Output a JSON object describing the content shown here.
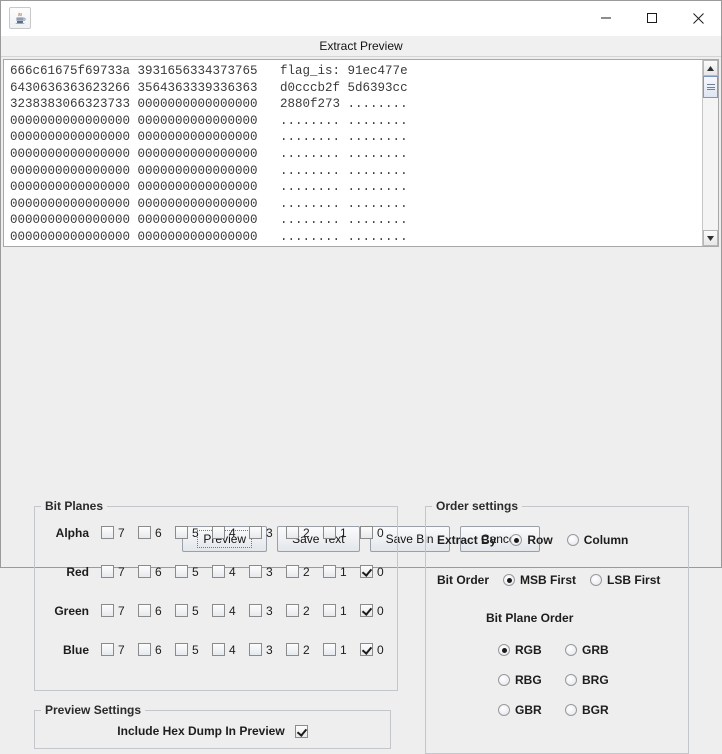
{
  "window": {
    "app_icon": "java-coffee-cup-icon",
    "title": "Extract Preview",
    "controls": {
      "minimize": "minimize-icon",
      "maximize": "maximize-icon",
      "close": "close-icon"
    }
  },
  "preview": {
    "scrollbar": {
      "up": "scroll-up-arrow-icon",
      "down": "scroll-down-arrow-icon"
    },
    "hex_lines": [
      "666c61675f69733a 3931656334373765   flag_is: 91ec477e",
      "6430636363623266 3564363339336363   d0cccb2f 5d6393cc",
      "3238383066323733 0000000000000000   2880f273 ........",
      "0000000000000000 0000000000000000   ........ ........",
      "0000000000000000 0000000000000000   ........ ........",
      "0000000000000000 0000000000000000   ........ ........",
      "0000000000000000 0000000000000000   ........ ........",
      "0000000000000000 0000000000000000   ........ ........",
      "0000000000000000 0000000000000000   ........ ........",
      "0000000000000000 0000000000000000   ........ ........",
      "0000000000000000 0000000000000000   ........ ........"
    ]
  },
  "bit_planes": {
    "legend": "Bit Planes",
    "bit_labels": [
      "7",
      "6",
      "5",
      "4",
      "3",
      "2",
      "1",
      "0"
    ],
    "rows": [
      {
        "channel": "Alpha",
        "checked": [
          false,
          false,
          false,
          false,
          false,
          false,
          false,
          false
        ]
      },
      {
        "channel": "Red",
        "checked": [
          false,
          false,
          false,
          false,
          false,
          false,
          false,
          true
        ]
      },
      {
        "channel": "Green",
        "checked": [
          false,
          false,
          false,
          false,
          false,
          false,
          false,
          true
        ]
      },
      {
        "channel": "Blue",
        "checked": [
          false,
          false,
          false,
          false,
          false,
          false,
          false,
          true
        ]
      }
    ]
  },
  "preview_settings": {
    "legend": "Preview Settings",
    "include_hex_dump_label": "Include Hex Dump In Preview",
    "include_hex_dump_checked": true
  },
  "order_settings": {
    "legend": "Order settings",
    "extract_by": {
      "label": "Extract By",
      "options": [
        "Row",
        "Column"
      ],
      "selected": "Row"
    },
    "bit_order": {
      "label": "Bit Order",
      "options": [
        "MSB First",
        "LSB First"
      ],
      "selected": "MSB First"
    },
    "bit_plane_order": {
      "label": "Bit Plane Order",
      "options": [
        "RGB",
        "GRB",
        "RBG",
        "BRG",
        "GBR",
        "BGR"
      ],
      "selected": "RGB"
    }
  },
  "buttons": [
    {
      "label": "Preview",
      "focused": true
    },
    {
      "label": "Save Text",
      "focused": false
    },
    {
      "label": "Save Bin",
      "focused": false
    },
    {
      "label": "Cancel",
      "focused": false
    }
  ],
  "colors": {
    "window_bg": "#eeeeee",
    "panel_border": "#c3c7cc",
    "text": "#1d1d1d",
    "hex_text": "#3a3a3a",
    "scroll_thumb": "#dfe6f2"
  }
}
